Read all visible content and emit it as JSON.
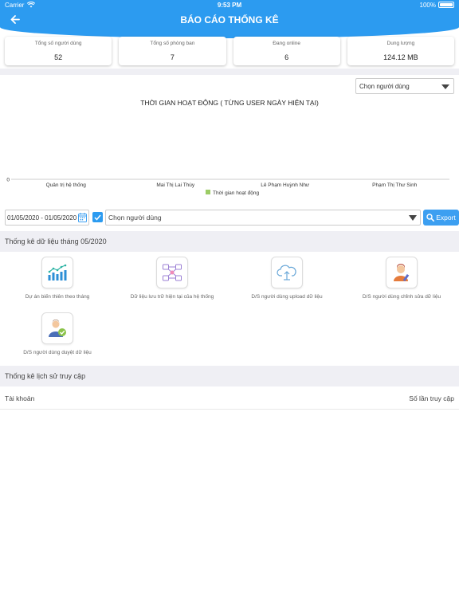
{
  "status_bar": {
    "carrier": "Carrier",
    "time": "9:53 PM",
    "battery": "100%"
  },
  "header": {
    "title": "BÁO CÁO THỐNG KÊ",
    "back_icon": "arrow-left-icon"
  },
  "stats": [
    {
      "label": "Tổng số người dùng",
      "value": "52"
    },
    {
      "label": "Tổng số phòng ban",
      "value": "7"
    },
    {
      "label": "Đang online",
      "value": "6"
    },
    {
      "label": "Dung lượng",
      "value": "124.12 MB"
    }
  ],
  "chart_filter": {
    "placeholder": "Chọn người dùng"
  },
  "chart_data": {
    "type": "bar",
    "title": "THỜI GIAN HOẠT ĐỘNG ( TỪNG USER NGÀY HIỆN TẠI)",
    "categories": [
      "Quản trị hệ thống",
      "Mai Thị Lai Thùy",
      "Lê Phạm Huỳnh Như",
      "Phạm Thị Thư Sinh"
    ],
    "series": [
      {
        "name": "Thời gian hoạt động",
        "values": [
          0,
          0,
          0,
          0
        ],
        "color": "#9ccc65"
      }
    ],
    "y_ticks": [
      "0"
    ],
    "legend_position": "bottom-center",
    "grid": false
  },
  "filters": {
    "date_range": "01/05/2020 - 01/05/2020",
    "checkbox_checked": true,
    "user_placeholder": "Chọn người dùng",
    "export_label": "Export"
  },
  "monthly_section": {
    "title": "Thống kê dữ liệu tháng 05/2020",
    "tiles": [
      {
        "label": "Dự án biến thiên theo tháng",
        "icon": "bar-chart-icon"
      },
      {
        "label": "Dữ liệu lưu trữ hiện tại của hệ thống",
        "icon": "network-icon"
      },
      {
        "label": "D/S người dùng upload dữ liệu",
        "icon": "cloud-upload-icon"
      },
      {
        "label": "D/S người dùng chỉnh sửa dữ liệu",
        "icon": "user-edit-icon"
      },
      {
        "label": "D/S người dùng duyệt dữ liệu",
        "icon": "user-approve-icon"
      }
    ]
  },
  "history_section": {
    "title": "Thống kê lịch sử truy cập",
    "col_account": "Tài khoản",
    "col_count": "Số lần truy cập"
  },
  "colors": {
    "primary": "#2c9bf0",
    "background_gray": "#efeff4",
    "legend_green": "#9ccc65"
  }
}
